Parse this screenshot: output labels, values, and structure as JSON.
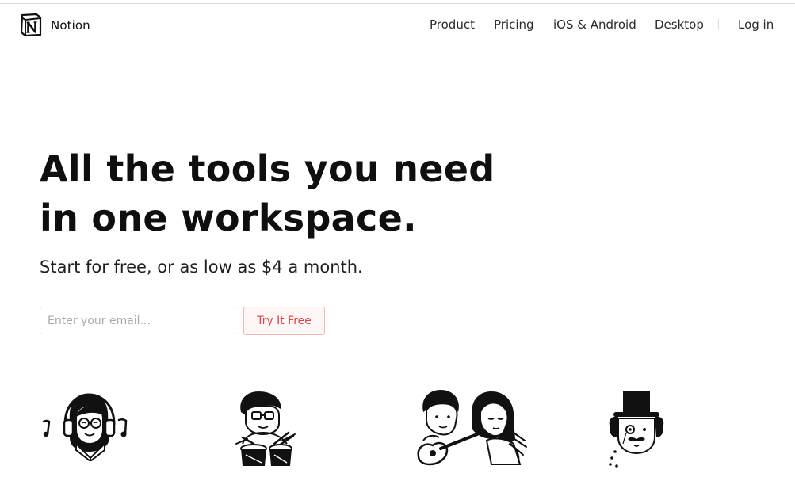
{
  "brand": {
    "name": "Notion",
    "logo_letter": "N"
  },
  "nav": {
    "items": [
      "Product",
      "Pricing",
      "iOS & Android",
      "Desktop"
    ],
    "login": "Log in"
  },
  "hero": {
    "title_line1": "All the tools you need",
    "title_line2": "in one workspace.",
    "subtitle": "Start for free, or as low as $4 a month."
  },
  "signup": {
    "email_placeholder": "Enter your email...",
    "cta": "Try It Free"
  },
  "illustrations": [
    {
      "icon": "headphones-person-icon"
    },
    {
      "icon": "drummer-person-icon"
    },
    {
      "icon": "guitar-duo-icon"
    },
    {
      "icon": "top-hat-monocle-icon"
    }
  ],
  "colors": {
    "text": "#111111",
    "cta_text": "#d84848",
    "cta_border": "#f3b6b6",
    "cta_bg": "#fff6f6"
  }
}
